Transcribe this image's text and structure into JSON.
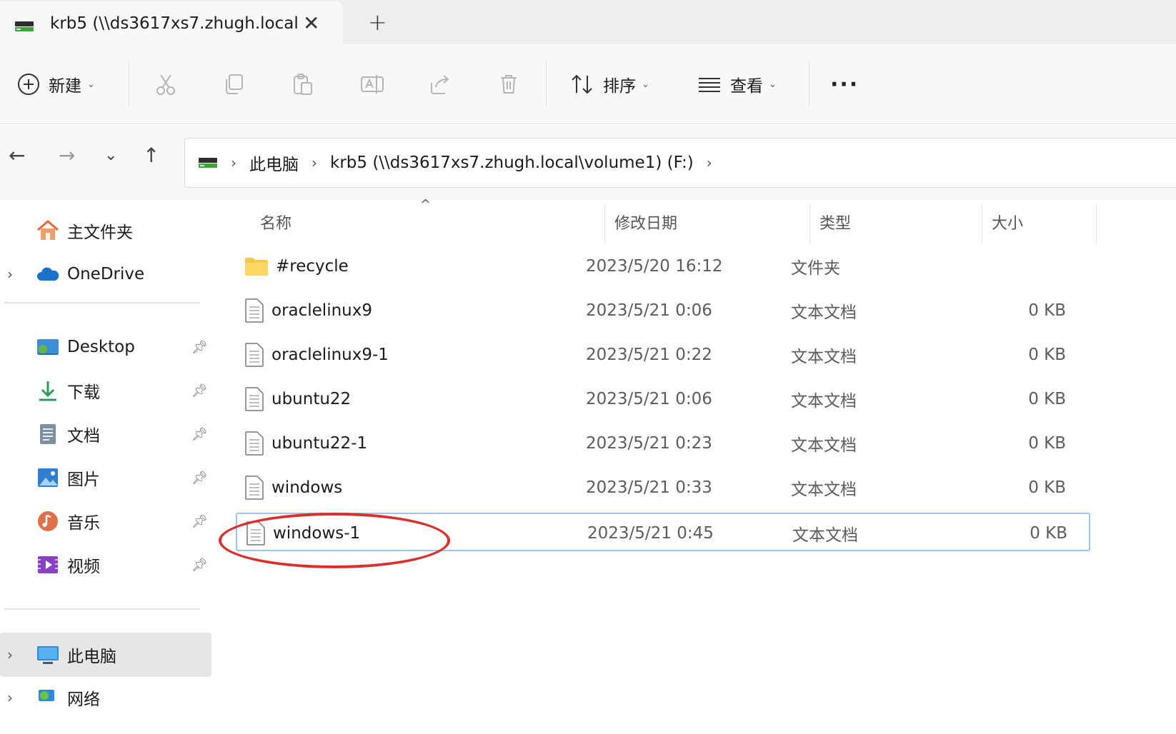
{
  "tab": {
    "title": "krb5 (\\\\ds3617xs7.zhugh.local",
    "close_label": "✕",
    "new_tab_label": "+"
  },
  "toolbar": {
    "new_label": "新建",
    "sort_label": "排序",
    "view_label": "查看",
    "more_label": "···"
  },
  "address": {
    "crumbs": [
      "此电脑",
      "krb5 (\\\\ds3617xs7.zhugh.local\\volume1) (F:)"
    ]
  },
  "sidebar": {
    "items": [
      {
        "label": "主文件夹"
      },
      {
        "label": "OneDrive"
      },
      {
        "label": "Desktop"
      },
      {
        "label": "下载"
      },
      {
        "label": "文档"
      },
      {
        "label": "图片"
      },
      {
        "label": "音乐"
      },
      {
        "label": "视频"
      },
      {
        "label": "此电脑"
      },
      {
        "label": "网络"
      }
    ]
  },
  "columns": {
    "name": "名称",
    "date": "修改日期",
    "type": "类型",
    "size": "大小"
  },
  "files": [
    {
      "name": "#recycle",
      "date": "2023/5/20 16:12",
      "type": "文件夹",
      "size": "",
      "icon": "folder-icon"
    },
    {
      "name": "oraclelinux9",
      "date": "2023/5/21 0:06",
      "type": "文本文档",
      "size": "0 KB",
      "icon": "text-file-icon"
    },
    {
      "name": "oraclelinux9-1",
      "date": "2023/5/21 0:22",
      "type": "文本文档",
      "size": "0 KB",
      "icon": "text-file-icon"
    },
    {
      "name": "ubuntu22",
      "date": "2023/5/21 0:06",
      "type": "文本文档",
      "size": "0 KB",
      "icon": "text-file-icon"
    },
    {
      "name": "ubuntu22-1",
      "date": "2023/5/21 0:23",
      "type": "文本文档",
      "size": "0 KB",
      "icon": "text-file-icon"
    },
    {
      "name": "windows",
      "date": "2023/5/21 0:33",
      "type": "文本文档",
      "size": "0 KB",
      "icon": "text-file-icon"
    },
    {
      "name": "windows-1",
      "date": "2023/5/21 0:45",
      "type": "文本文档",
      "size": "0 KB",
      "icon": "text-file-icon"
    }
  ],
  "colors": {
    "selection_border": "#9cc3ea",
    "annotation": "#d9302e",
    "folder": "#f7c948"
  }
}
